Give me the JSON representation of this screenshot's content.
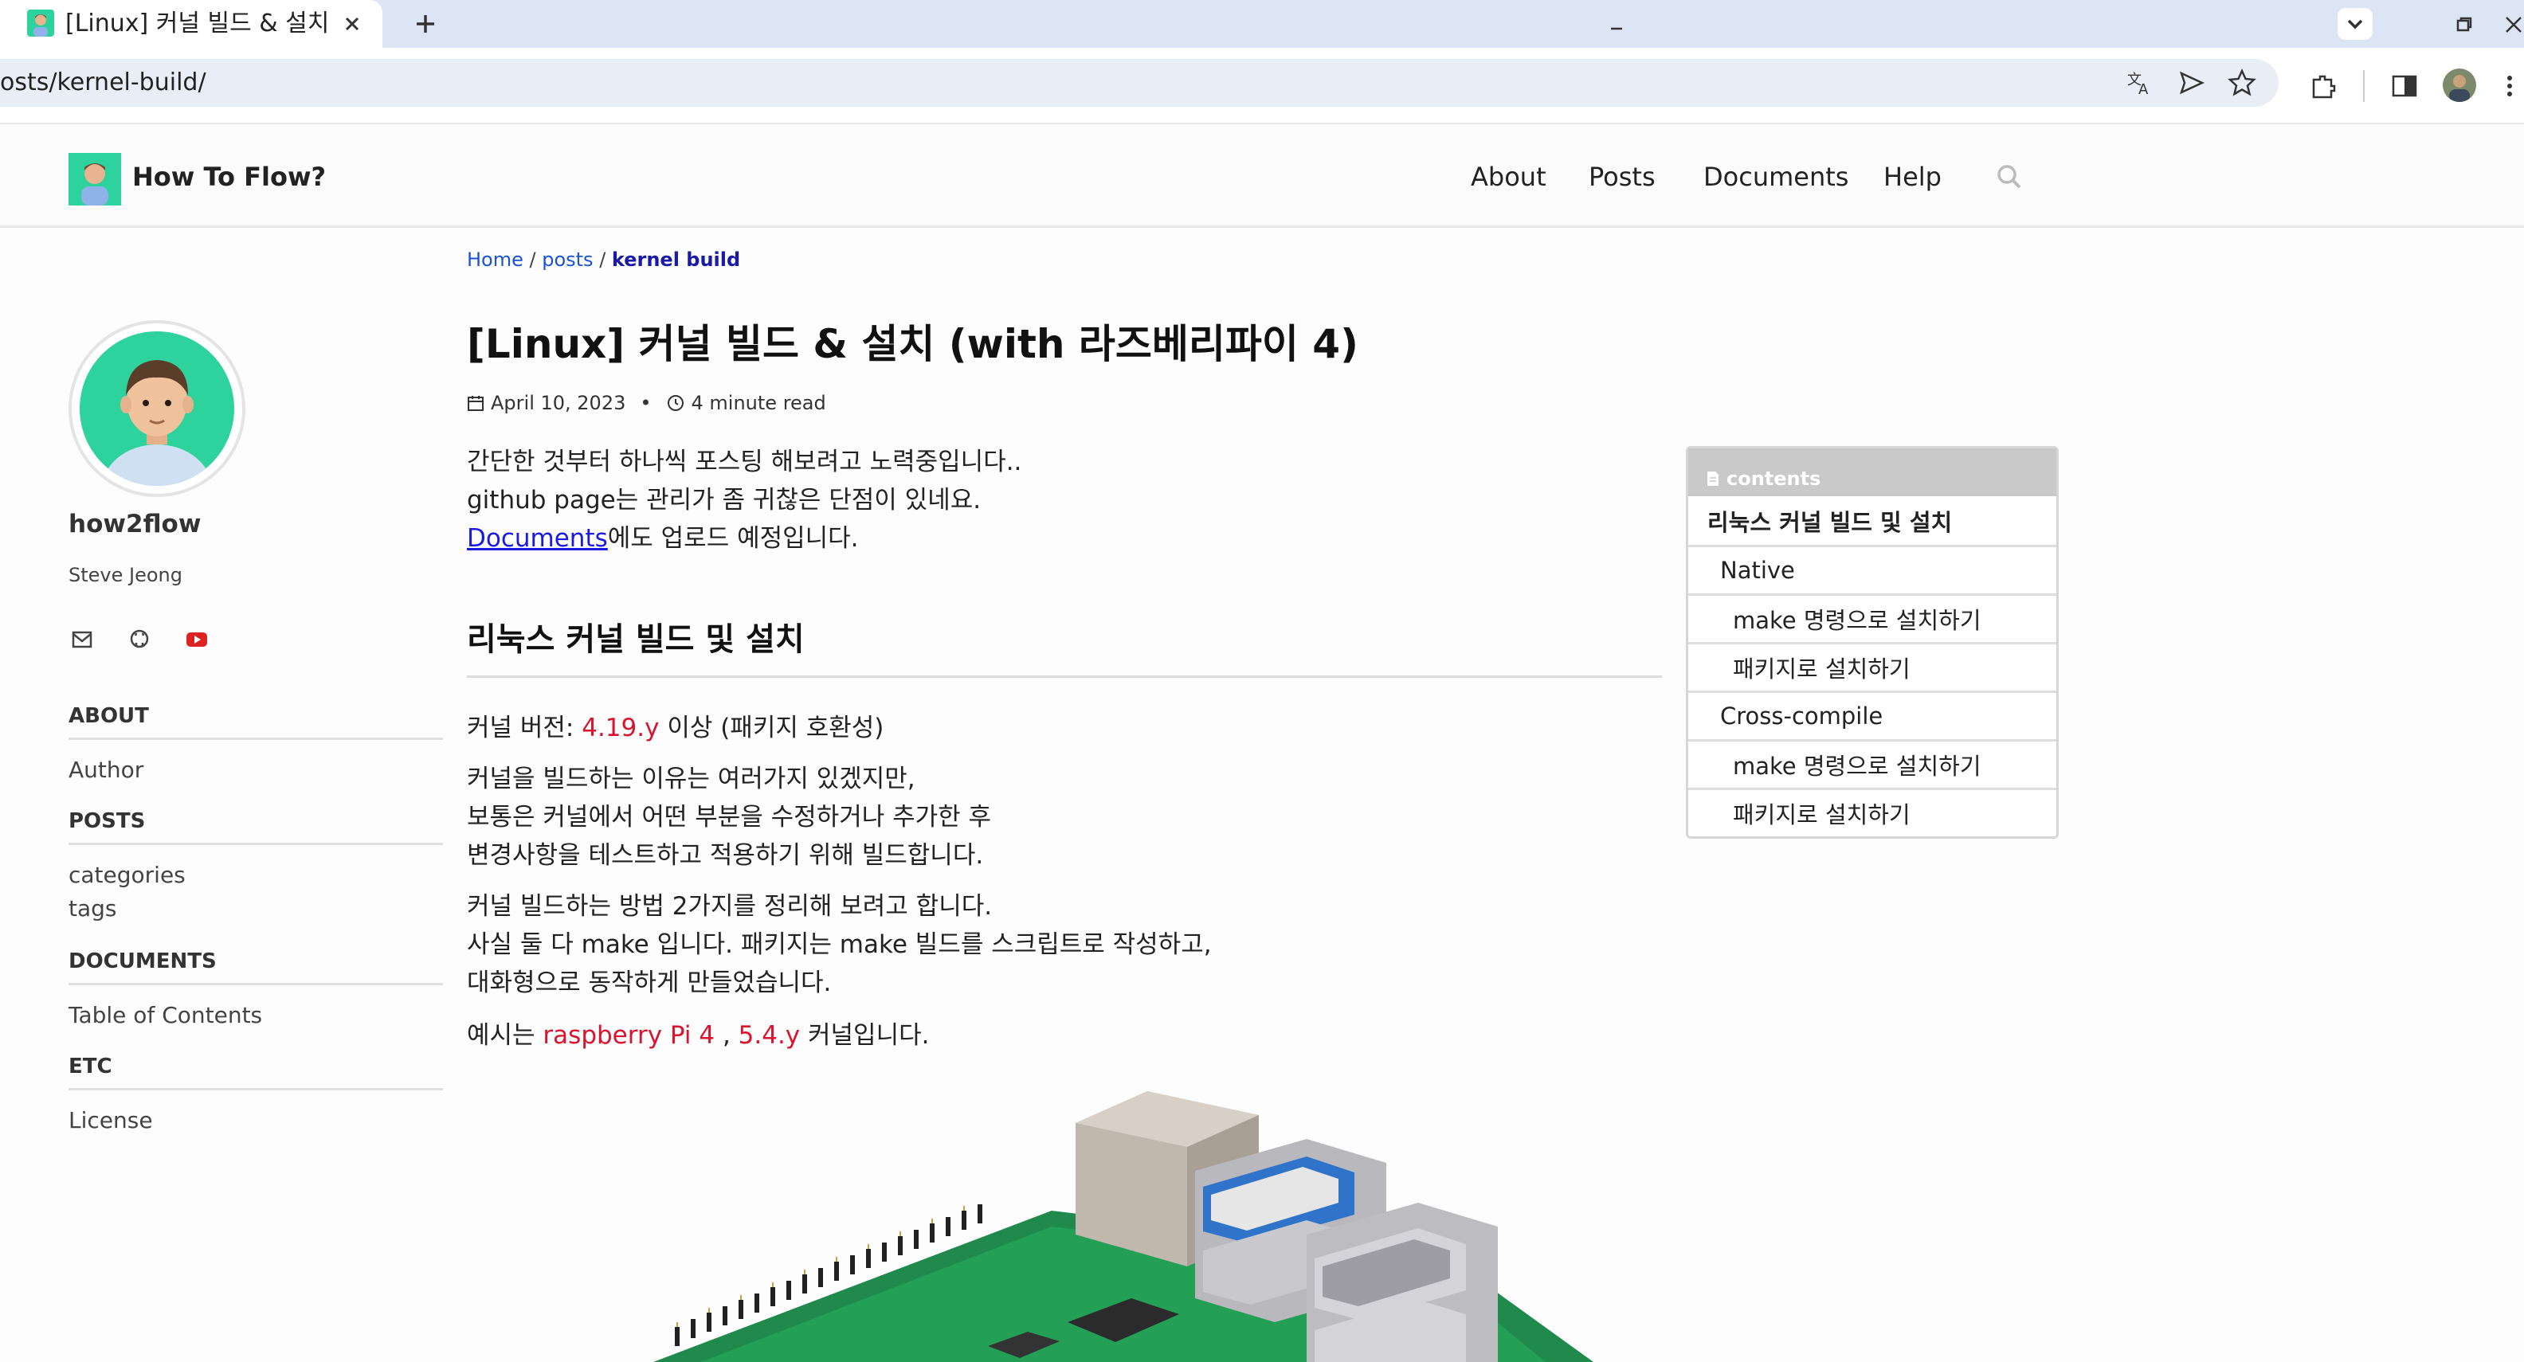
{
  "browser": {
    "tab_title": "[Linux] 커널 빌드 & 설치 (wi",
    "url": "osts/kernel-build/"
  },
  "site": {
    "title": "How To Flow?",
    "nav": [
      "About",
      "Posts",
      "Documents",
      "Help"
    ]
  },
  "sidebar": {
    "author_name": "how2flow",
    "author_real": "Steve Jeong",
    "sections": [
      {
        "heading": "ABOUT",
        "links": [
          "Author"
        ]
      },
      {
        "heading": "POSTS",
        "links": [
          "categories",
          "tags"
        ]
      },
      {
        "heading": "DOCUMENTS",
        "links": [
          "Table of Contents"
        ]
      },
      {
        "heading": "ETC",
        "links": [
          "License"
        ]
      }
    ]
  },
  "breadcrumb": {
    "home": "Home",
    "sep": " / ",
    "posts": "posts",
    "current": "kernel build"
  },
  "post": {
    "title": "[Linux] 커널 빌드 & 설치 (with 라즈베리파이 4)",
    "date": "April 10, 2023",
    "bullet": "•",
    "read_time": "4 minute read",
    "intro": [
      "간단한 것부터 하나씩 포스팅 해보려고 노력중입니다..",
      "github page는 관리가 좀 귀찮은 단점이 있네요."
    ],
    "intro_link": "Documents",
    "intro_link_suffix": "에도 업로드 예정입니다.",
    "h2": "리눅스 커널 빌드 및 설치",
    "version_prefix": "커널 버전: ",
    "version_value": "4.19.y",
    "version_suffix": " 이상 (패키지 호환성)",
    "p2": [
      "커널을 빌드하는 이유는 여러가지 있겠지만,",
      "보통은 커널에서 어떤 부분을 수정하거나 추가한 후",
      "변경사항을 테스트하고 적용하기 위해 빌드합니다."
    ],
    "p3": [
      "커널 빌드하는 방법 2가지를 정리해 보려고 합니다.",
      "사실 둘 다 make 입니다. 패키지는 make 빌드를 스크립트로 작성하고,",
      "대화형으로 동작하게 만들었습니다."
    ],
    "example_prefix": "예시는 ",
    "example_board": "raspberry Pi 4",
    "example_sep": " , ",
    "example_version": "5.4.y",
    "example_suffix": " 커널입니다."
  },
  "toc": {
    "heading": "contents",
    "items": [
      {
        "label": "리눅스 커널 빌드 및 설치",
        "level": 1
      },
      {
        "label": "Native",
        "level": 2
      },
      {
        "label": "make 명령으로 설치하기",
        "level": 3
      },
      {
        "label": "패키지로 설치하기",
        "level": 3
      },
      {
        "label": "Cross-compile",
        "level": 2
      },
      {
        "label": "make 명령으로 설치하기",
        "level": 3
      },
      {
        "label": "패키지로 설치하기",
        "level": 3
      }
    ]
  },
  "colors": {
    "accent_link": "#1a53d6",
    "highlight_red": "#d8142f",
    "brand_green": "#2ed29c",
    "tabbar": "#dce5f3"
  }
}
